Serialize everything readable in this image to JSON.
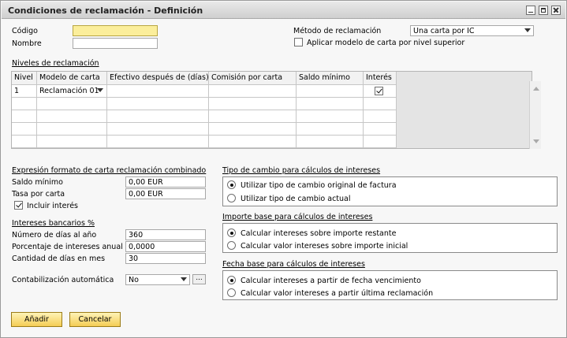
{
  "window": {
    "title": "Condiciones de reclamación - Definición"
  },
  "header": {
    "codigo_label": "Código",
    "codigo_value": "",
    "nombre_label": "Nombre",
    "nombre_value": "",
    "metodo_label": "Método de reclamación",
    "metodo_value": "Una carta por IC",
    "aplicar_label": "Aplicar modelo de carta por nivel superior",
    "aplicar_checked": false
  },
  "levels": {
    "section_label": "Niveles de reclamación",
    "columns": [
      "Nivel",
      "Modelo de carta",
      "Efectivo después de (días)",
      "Comisión por carta",
      "Saldo mínimo",
      "Interés"
    ],
    "rows": [
      {
        "nivel": "1",
        "modelo": "Reclamación 01",
        "efectivo": "",
        "comision": "",
        "saldo": "",
        "interes": true
      }
    ]
  },
  "letter_format": {
    "section_label": "Expresión formato de carta reclamación combinado",
    "saldo_label": "Saldo mínimo",
    "saldo_value": "0,00 EUR",
    "tasa_label": "Tasa por carta",
    "tasa_value": "0,00 EUR",
    "incluir_label": "Incluir interés",
    "incluir_checked": true
  },
  "bank_interest": {
    "section_label": "Intereses bancarios %",
    "dias_label": "Número de días al año",
    "dias_value": "360",
    "porcentaje_label": "Porcentaje de intereses anual",
    "porcentaje_value": "0,0000",
    "cantidad_label": "Cantidad de días en mes",
    "cantidad_value": "30",
    "contab_label": "Contabilización automática",
    "contab_value": "No"
  },
  "exchange": {
    "section_label": "Tipo de cambio para cálculos de intereses",
    "options": [
      "Utilizar tipo de cambio original de factura",
      "Utilizar tipo de cambio actual"
    ],
    "selected": 0
  },
  "base_amount": {
    "section_label": "Importe base para cálculos de intereses",
    "options": [
      "Calcular intereses sobre importe restante",
      "Calcular valor intereses sobre importe inicial"
    ],
    "selected": 0
  },
  "base_date": {
    "section_label": "Fecha base para cálculos de intereses",
    "options": [
      "Calcular intereses a partir de fecha vencimiento",
      "Calcular valor intereses a partir última reclamación"
    ],
    "selected": 0
  },
  "footer": {
    "add_label": "Añadir",
    "cancel_label": "Cancelar"
  },
  "colors": {
    "accent_yellow": "#f4cd55",
    "field_yellow": "#fbee9b"
  }
}
